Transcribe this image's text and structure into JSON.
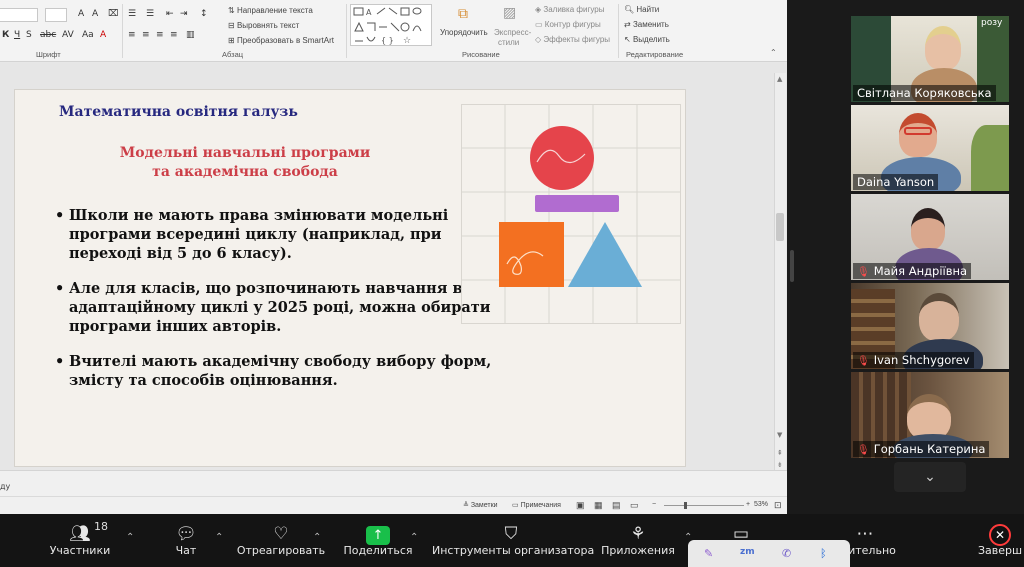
{
  "ribbon": {
    "font_label": "Шрифт",
    "paragraph_label": "Абзац",
    "drawing_label": "Рисование",
    "editing_label": "Редактирование",
    "text_direction": "Направление текста",
    "align_text": "Выровнять текст",
    "convert_smartart": "Преобразовать в SmartArt",
    "arrange": "Упорядочить",
    "quick_styles_1": "Экспресс-",
    "quick_styles_2": "стили",
    "shape_fill": "Заливка фигуры",
    "shape_outline": "Контур фигуры",
    "shape_effects": "Эффекты фигуры",
    "find": "Найти",
    "replace": "Заменить",
    "select": "Выделить"
  },
  "slide": {
    "title": "Математична освітня галузь",
    "subtitle_line1": "Модельні навчальні програми",
    "subtitle_line2": "та академічна свобода",
    "bullets": [
      "Школи не мають права змінювати модельні програми всередині циклу (наприклад, при переході від 5 до 6 класу).",
      "Але для класів, що розпочинають навчання в адаптаційному циклі у 2025 році, можна обирати програми інших авторів.",
      "Вчителі мають академічну свободу вибору форм, змісту та способів оцінювання."
    ]
  },
  "notes_stub": "ду",
  "status": {
    "notes": "Заметки",
    "comments": "Примечания",
    "zoom": "53%"
  },
  "participants": [
    {
      "name": "Світлана Коряковська",
      "muted": false,
      "active": true
    },
    {
      "name": "Daina Yanson",
      "muted": false,
      "active": false
    },
    {
      "name": "Майя Андріївна",
      "muted": true,
      "active": false
    },
    {
      "name": "Ivan Shchygorev",
      "muted": true,
      "active": false
    },
    {
      "name": "Горбань Катерина",
      "muted": true,
      "active": false
    }
  ],
  "background_sign": "розу",
  "toolbar": {
    "participants_label": "Участники",
    "participants_count": "18",
    "chat_label": "Чат",
    "react_label": "Отреагировать",
    "share_label": "Поделиться",
    "host_tools_label": "Инструменты организатора",
    "apps_label": "Приложения",
    "more_label": "ительно",
    "end_label": "Заверш"
  },
  "colors": {
    "slide_title": "#26287f",
    "slide_subtitle": "#cc3e47",
    "share_green": "#19bf4a",
    "active_speaker": "#3ed05a",
    "circle_red": "#e5444b",
    "bar_purple": "#b16cd0",
    "square_orange": "#f37021",
    "triangle_blue": "#6aaed6"
  }
}
